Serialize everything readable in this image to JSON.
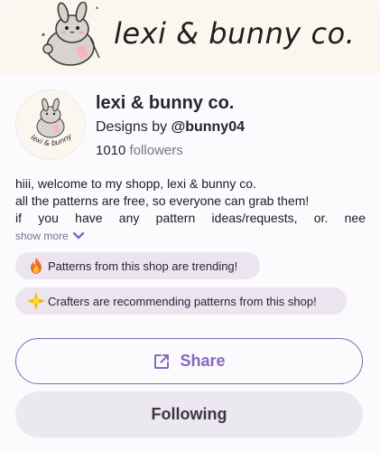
{
  "banner": {
    "title": "lexi & bunny co."
  },
  "shop": {
    "name": "lexi & bunny co.",
    "designs_by_prefix": "Designs by",
    "designer_handle": "@bunny04",
    "followers_count": "1010",
    "followers_label": "followers",
    "avatar_text": "lexi & bunny co."
  },
  "description": {
    "line1": "hiii, welcome to my shopp, lexi & bunny co.",
    "line2": "all the patterns are free, so everyone can grab them!",
    "line3": "if you have any pattern ideas/requests, or. nee",
    "show_more": "show more"
  },
  "badges": [
    {
      "icon": "fire-icon",
      "text": "Patterns from this shop are trending!"
    },
    {
      "icon": "sparkle-icon",
      "text": "Crafters are recommending patterns from this shop!"
    }
  ],
  "actions": {
    "share_label": "Share",
    "following_label": "Following"
  },
  "colors": {
    "accent": "#8a65c1",
    "banner_bg": "#fbf6ee",
    "badge_bg": "#ece5f0"
  }
}
